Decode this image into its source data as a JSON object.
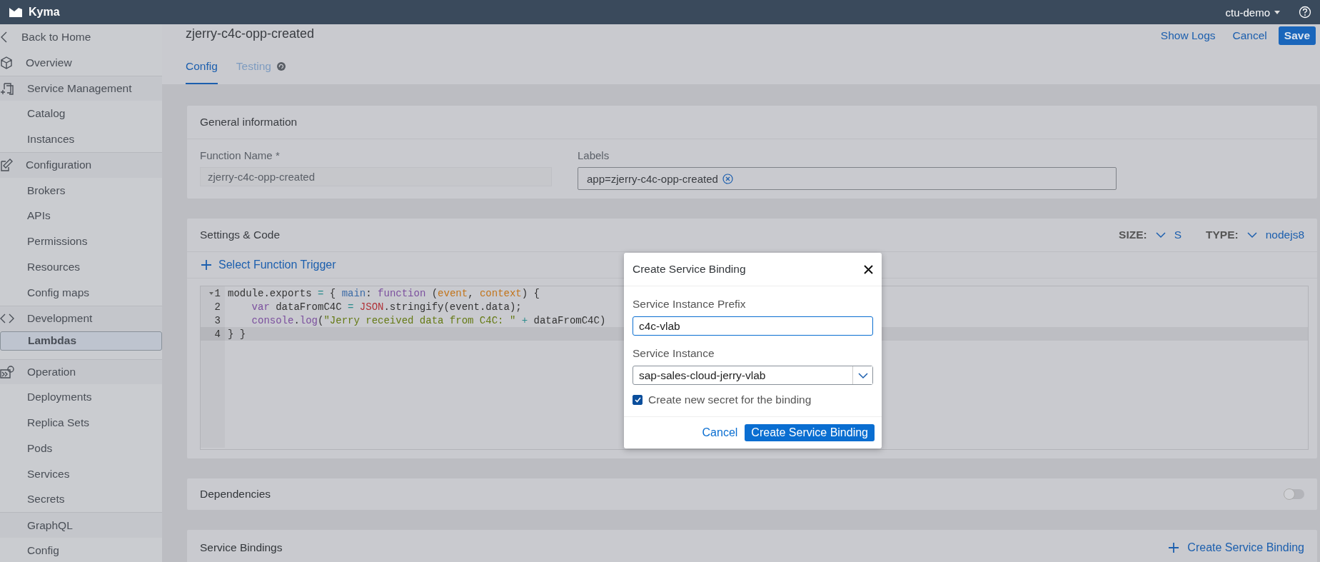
{
  "header": {
    "brand": "Kyma",
    "user": "ctu-demo"
  },
  "sidebar": {
    "items": [
      {
        "label": "Back to Home",
        "kind": "back",
        "selected": false
      },
      {
        "label": "Overview",
        "kind": "link",
        "selected": false
      },
      {
        "label": "Service Management",
        "kind": "group",
        "selected": false
      },
      {
        "label": "Catalog",
        "kind": "link",
        "selected": false
      },
      {
        "label": "Instances",
        "kind": "link",
        "selected": false
      },
      {
        "label": "Configuration",
        "kind": "group",
        "selected": false
      },
      {
        "label": "Brokers",
        "kind": "link",
        "selected": false
      },
      {
        "label": "APIs",
        "kind": "link",
        "selected": false
      },
      {
        "label": "Permissions",
        "kind": "link",
        "selected": false
      },
      {
        "label": "Resources",
        "kind": "link",
        "selected": false
      },
      {
        "label": "Config maps",
        "kind": "link",
        "selected": false
      },
      {
        "label": "Development",
        "kind": "group",
        "selected": false
      },
      {
        "label": "Lambdas",
        "kind": "link",
        "selected": true
      },
      {
        "label": "Operation",
        "kind": "group",
        "selected": false
      },
      {
        "label": "Deployments",
        "kind": "link",
        "selected": false
      },
      {
        "label": "Replica Sets",
        "kind": "link",
        "selected": false
      },
      {
        "label": "Pods",
        "kind": "link",
        "selected": false
      },
      {
        "label": "Services",
        "kind": "link",
        "selected": false
      },
      {
        "label": "Secrets",
        "kind": "link",
        "selected": false
      },
      {
        "label": "GraphQL",
        "kind": "group",
        "selected": false
      },
      {
        "label": "Config",
        "kind": "link",
        "selected": false
      }
    ]
  },
  "page": {
    "title": "zjerry-c4c-opp-created",
    "actions": [
      {
        "label": "Show Logs",
        "kind": "link"
      },
      {
        "label": "Cancel",
        "kind": "link"
      },
      {
        "label": "Save",
        "kind": "primary"
      }
    ]
  },
  "tabs": [
    {
      "label": "Config",
      "selected": true
    },
    {
      "label": "Testing",
      "selected": false
    }
  ],
  "general": {
    "title": "General information",
    "function_name": {
      "label": "Function Name *",
      "value": "zjerry-c4c-opp-created",
      "disabled": true
    },
    "labels": {
      "label": "Labels",
      "tokens": [
        "app=zjerry-c4c-opp-created"
      ]
    }
  },
  "settings": {
    "title": "Settings & Code",
    "size_label": "SIZE:",
    "size": "S",
    "type_label": "TYPE:",
    "type": "nodejs8",
    "trigger": "Select Function Trigger",
    "code": [
      {
        "number": "1",
        "foldable": true,
        "active": false,
        "tokens": [
          {
            "text": "module.exports ",
            "kind": "plain"
          },
          {
            "text": "=",
            "kind": "operator"
          },
          {
            "text": " { ",
            "kind": "plain"
          },
          {
            "text": "main",
            "kind": "property"
          },
          {
            "text": ": ",
            "kind": "plain"
          },
          {
            "text": "function",
            "kind": "keyword"
          },
          {
            "text": " (",
            "kind": "plain"
          },
          {
            "text": "event",
            "kind": "param"
          },
          {
            "text": ", ",
            "kind": "plain"
          },
          {
            "text": "context",
            "kind": "param"
          },
          {
            "text": ") {",
            "kind": "plain"
          }
        ]
      },
      {
        "number": "2",
        "foldable": false,
        "active": false,
        "indented": true,
        "tokens": [
          {
            "text": "var",
            "kind": "keyword"
          },
          {
            "text": " dataFromC4C ",
            "kind": "plain"
          },
          {
            "text": "= ",
            "kind": "operator"
          },
          {
            "text": "JSON",
            "kind": "builtin"
          },
          {
            "text": ".stringify(event.data);",
            "kind": "plain"
          }
        ]
      },
      {
        "number": "3",
        "foldable": false,
        "active": false,
        "indented": true,
        "tokens": [
          {
            "text": "console",
            "kind": "keyword"
          },
          {
            "text": ".",
            "kind": "plain"
          },
          {
            "text": "log",
            "kind": "keyword"
          },
          {
            "text": "(",
            "kind": "plain"
          },
          {
            "text": "\"Jerry received data from C4C: \"",
            "kind": "string"
          },
          {
            "text": " + ",
            "kind": "operator"
          },
          {
            "text": "dataFromC4C)",
            "kind": "plain"
          }
        ]
      },
      {
        "number": "4",
        "foldable": false,
        "active": true,
        "tokens": [
          {
            "text": "} }",
            "kind": "plain"
          }
        ]
      }
    ]
  },
  "dependencies": {
    "title": "Dependencies",
    "on": false
  },
  "service_bindings": {
    "title": "Service Bindings",
    "action": "Create Service Binding"
  },
  "dialog": {
    "title": "Create Service Binding",
    "prefix": {
      "label": "Service Instance Prefix",
      "value": "c4c-vlab"
    },
    "instance": {
      "label": "Service Instance",
      "value": "sap-sales-cloud-jerry-vlab"
    },
    "secret": {
      "label": "Create new secret for the binding",
      "checked": true
    },
    "buttons": [
      {
        "label": "Cancel",
        "kind": "link"
      },
      {
        "label": "Create Service Binding",
        "kind": "primary"
      }
    ]
  }
}
